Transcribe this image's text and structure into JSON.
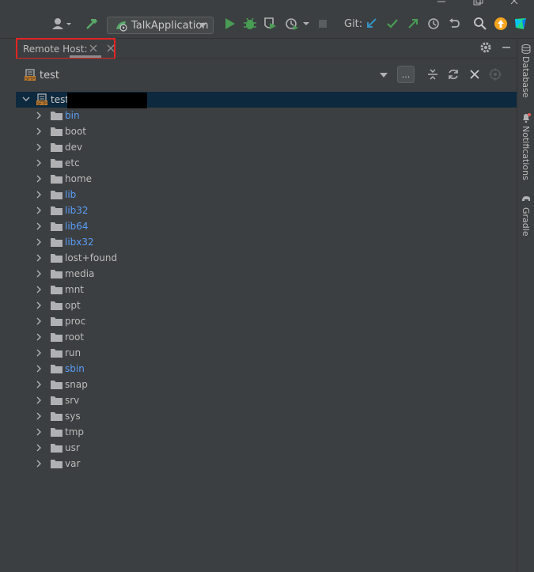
{
  "toolbar": {
    "run_config_label": "TalkApplication",
    "git_label": "Git:"
  },
  "tab": {
    "label": "Remote Host:"
  },
  "host": {
    "name": "test"
  },
  "more_button_label": "...",
  "tree": {
    "root_label": "test",
    "items": [
      {
        "name": "bin",
        "symlink": true
      },
      {
        "name": "boot",
        "symlink": false
      },
      {
        "name": "dev",
        "symlink": false
      },
      {
        "name": "etc",
        "symlink": false
      },
      {
        "name": "home",
        "symlink": false
      },
      {
        "name": "lib",
        "symlink": true
      },
      {
        "name": "lib32",
        "symlink": true
      },
      {
        "name": "lib64",
        "symlink": true
      },
      {
        "name": "libx32",
        "symlink": true
      },
      {
        "name": "lost+found",
        "symlink": false
      },
      {
        "name": "media",
        "symlink": false
      },
      {
        "name": "mnt",
        "symlink": false
      },
      {
        "name": "opt",
        "symlink": false
      },
      {
        "name": "proc",
        "symlink": false
      },
      {
        "name": "root",
        "symlink": false
      },
      {
        "name": "run",
        "symlink": false
      },
      {
        "name": "sbin",
        "symlink": true
      },
      {
        "name": "snap",
        "symlink": false
      },
      {
        "name": "srv",
        "symlink": false
      },
      {
        "name": "sys",
        "symlink": false
      },
      {
        "name": "tmp",
        "symlink": false
      },
      {
        "name": "usr",
        "symlink": false
      },
      {
        "name": "var",
        "symlink": false
      }
    ]
  },
  "side_tools": {
    "database": "Database",
    "notifications": "Notifications",
    "gradle": "Gradle"
  },
  "colors": {
    "symlink_text": "#589df6",
    "normal_text": "#bbbbbb",
    "selection": "#0d293e",
    "highlight_box": "#e52323"
  }
}
